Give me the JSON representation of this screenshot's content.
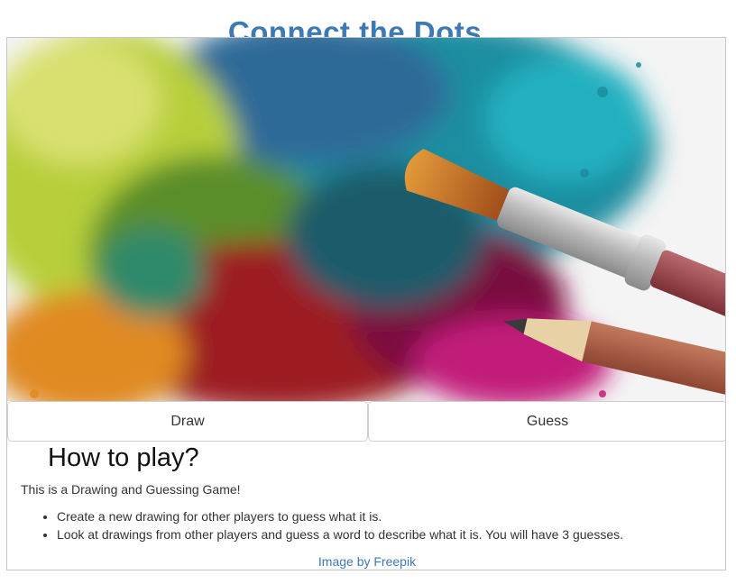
{
  "page": {
    "title": "Connect the Dots..."
  },
  "hero": {
    "alt": "Colorful paint splash with brush and pencil"
  },
  "actions": {
    "draw_label": "Draw",
    "guess_label": "Guess"
  },
  "howto": {
    "heading": "How to play?",
    "intro": "This is a Drawing and Guessing Game!",
    "rules": [
      "Create a new drawing for other players to guess what it is.",
      "Look at drawings from other players and guess a word to describe what it is. You will have 3 guesses."
    ]
  },
  "credit": {
    "text": "Image by Freepik"
  },
  "colors": {
    "accent": "#3d7ab5",
    "border": "#c8c8c8"
  }
}
